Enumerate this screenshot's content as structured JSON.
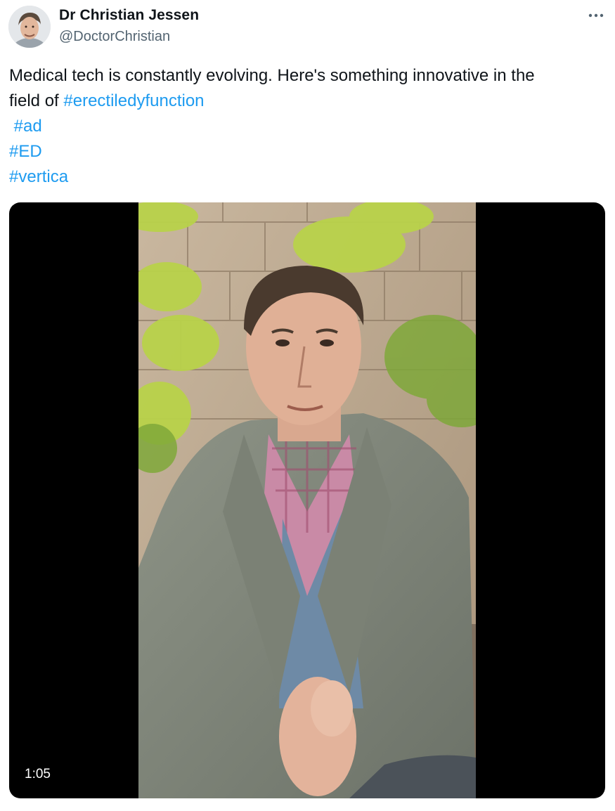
{
  "author": {
    "name": "Dr Christian Jessen",
    "handle": "@DoctorChristian",
    "avatar_icon": "user-avatar"
  },
  "menu": {
    "more_icon": "more-horizontal-icon",
    "more_label": "···"
  },
  "tweet": {
    "text_line1": "Medical tech is constantly evolving. Here's something innovative in the",
    "text_line2_prefix": "field of ",
    "hashtags": [
      "#erectiledyfunction",
      "#ad",
      "#ED",
      "#vertica"
    ]
  },
  "media": {
    "type": "video",
    "duration": "1:05"
  },
  "colors": {
    "text": "#0f1419",
    "secondary": "#536471",
    "link": "#1d9bf0",
    "media_bg": "#000000"
  }
}
